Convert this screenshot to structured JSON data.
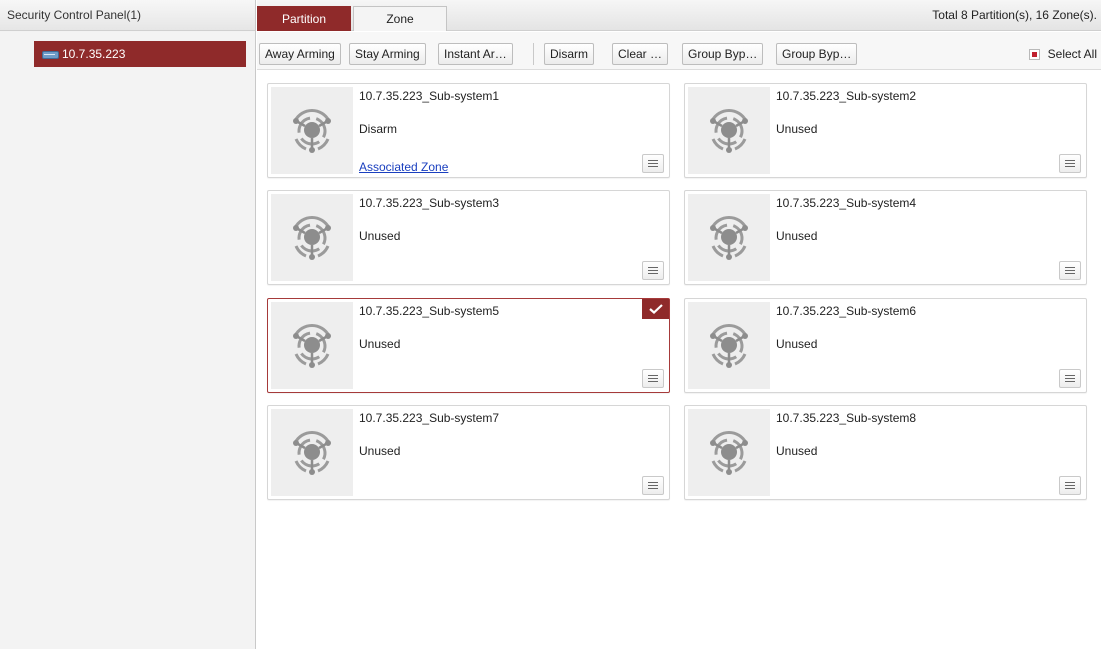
{
  "left_panel": {
    "header": "Security Control Panel(1)",
    "device": {
      "label": "10.7.35.223",
      "icon": "device-icon"
    }
  },
  "tabs": [
    {
      "label": "Partition",
      "active": true
    },
    {
      "label": "Zone",
      "active": false
    }
  ],
  "summary": "Total 8 Partition(s), 16 Zone(s).",
  "toolbar": {
    "buttons": [
      "Away Arming",
      "Stay Arming",
      "Instant Ar…",
      "Disarm",
      "Clear …",
      "Group Byp…",
      "Group Byp…"
    ],
    "select_all": {
      "label": "Select All",
      "checked": true
    }
  },
  "partitions": [
    {
      "name": "10.7.35.223_Sub-system1",
      "status": "Disarm",
      "link": "Associated Zone",
      "selected": false
    },
    {
      "name": "10.7.35.223_Sub-system2",
      "status": "Unused",
      "selected": false
    },
    {
      "name": "10.7.35.223_Sub-system3",
      "status": "Unused",
      "selected": false
    },
    {
      "name": "10.7.35.223_Sub-system4",
      "status": "Unused",
      "selected": false
    },
    {
      "name": "10.7.35.223_Sub-system5",
      "status": "Unused",
      "selected": true
    },
    {
      "name": "10.7.35.223_Sub-system6",
      "status": "Unused",
      "selected": false
    },
    {
      "name": "10.7.35.223_Sub-system7",
      "status": "Unused",
      "selected": false
    },
    {
      "name": "10.7.35.223_Sub-system8",
      "status": "Unused",
      "selected": false
    }
  ],
  "colors": {
    "accent": "#8f2a2a",
    "link": "#1a3fbf",
    "select_box": "#c0212f"
  },
  "icons": {
    "partition": "partition-icon",
    "card_menu": "list-menu-icon",
    "selected_check": "checkmark-icon"
  }
}
